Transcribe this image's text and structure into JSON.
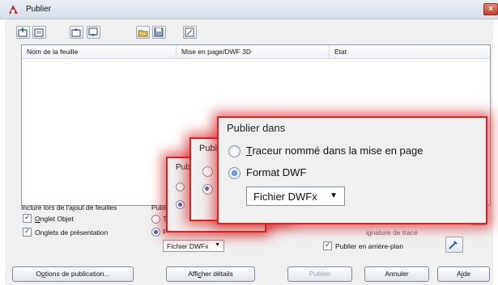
{
  "window": {
    "title": "Publier",
    "close_glyph": "×"
  },
  "toolbar": {
    "icons": [
      "add-sheets-icon",
      "remove-sheets-icon",
      "move-up-icon",
      "move-down-icon",
      "load-list-icon",
      "save-list-icon",
      "plot-stamp-icon"
    ]
  },
  "list": {
    "columns": [
      "Nom de la feuille",
      "Mise en page/DWF 3D",
      "Etat"
    ]
  },
  "include_group": {
    "label": "Inclure lors de l'ajout de feuilles",
    "model_tab": "Onglet Objet",
    "layout_tabs": "Onglets de présentation"
  },
  "publish_group": {
    "label_partial": "Publi",
    "opt1_partial": "T",
    "opt2_partial": "F",
    "select_value": "Fichier DWFx"
  },
  "options_group": {
    "plot_stamp_partial": "ignature de tracé",
    "background": "Publier en arrière-plan"
  },
  "buttons": {
    "options": "Options de publication...",
    "details": "Afficher détails",
    "publish": "Publier",
    "cancel": "Annuler",
    "help": "Aide"
  },
  "callout": {
    "title": "Publier dans",
    "title_partial_a": "Pub",
    "title_partial_b": "Publ",
    "option_plotter": "Traceur nommé dans la mise en page",
    "option_dwf": "Format DWF",
    "select_value": "Fichier DWFx"
  },
  "colors": {
    "accent": "#2e6fd1",
    "callout_border": "#e02020"
  }
}
